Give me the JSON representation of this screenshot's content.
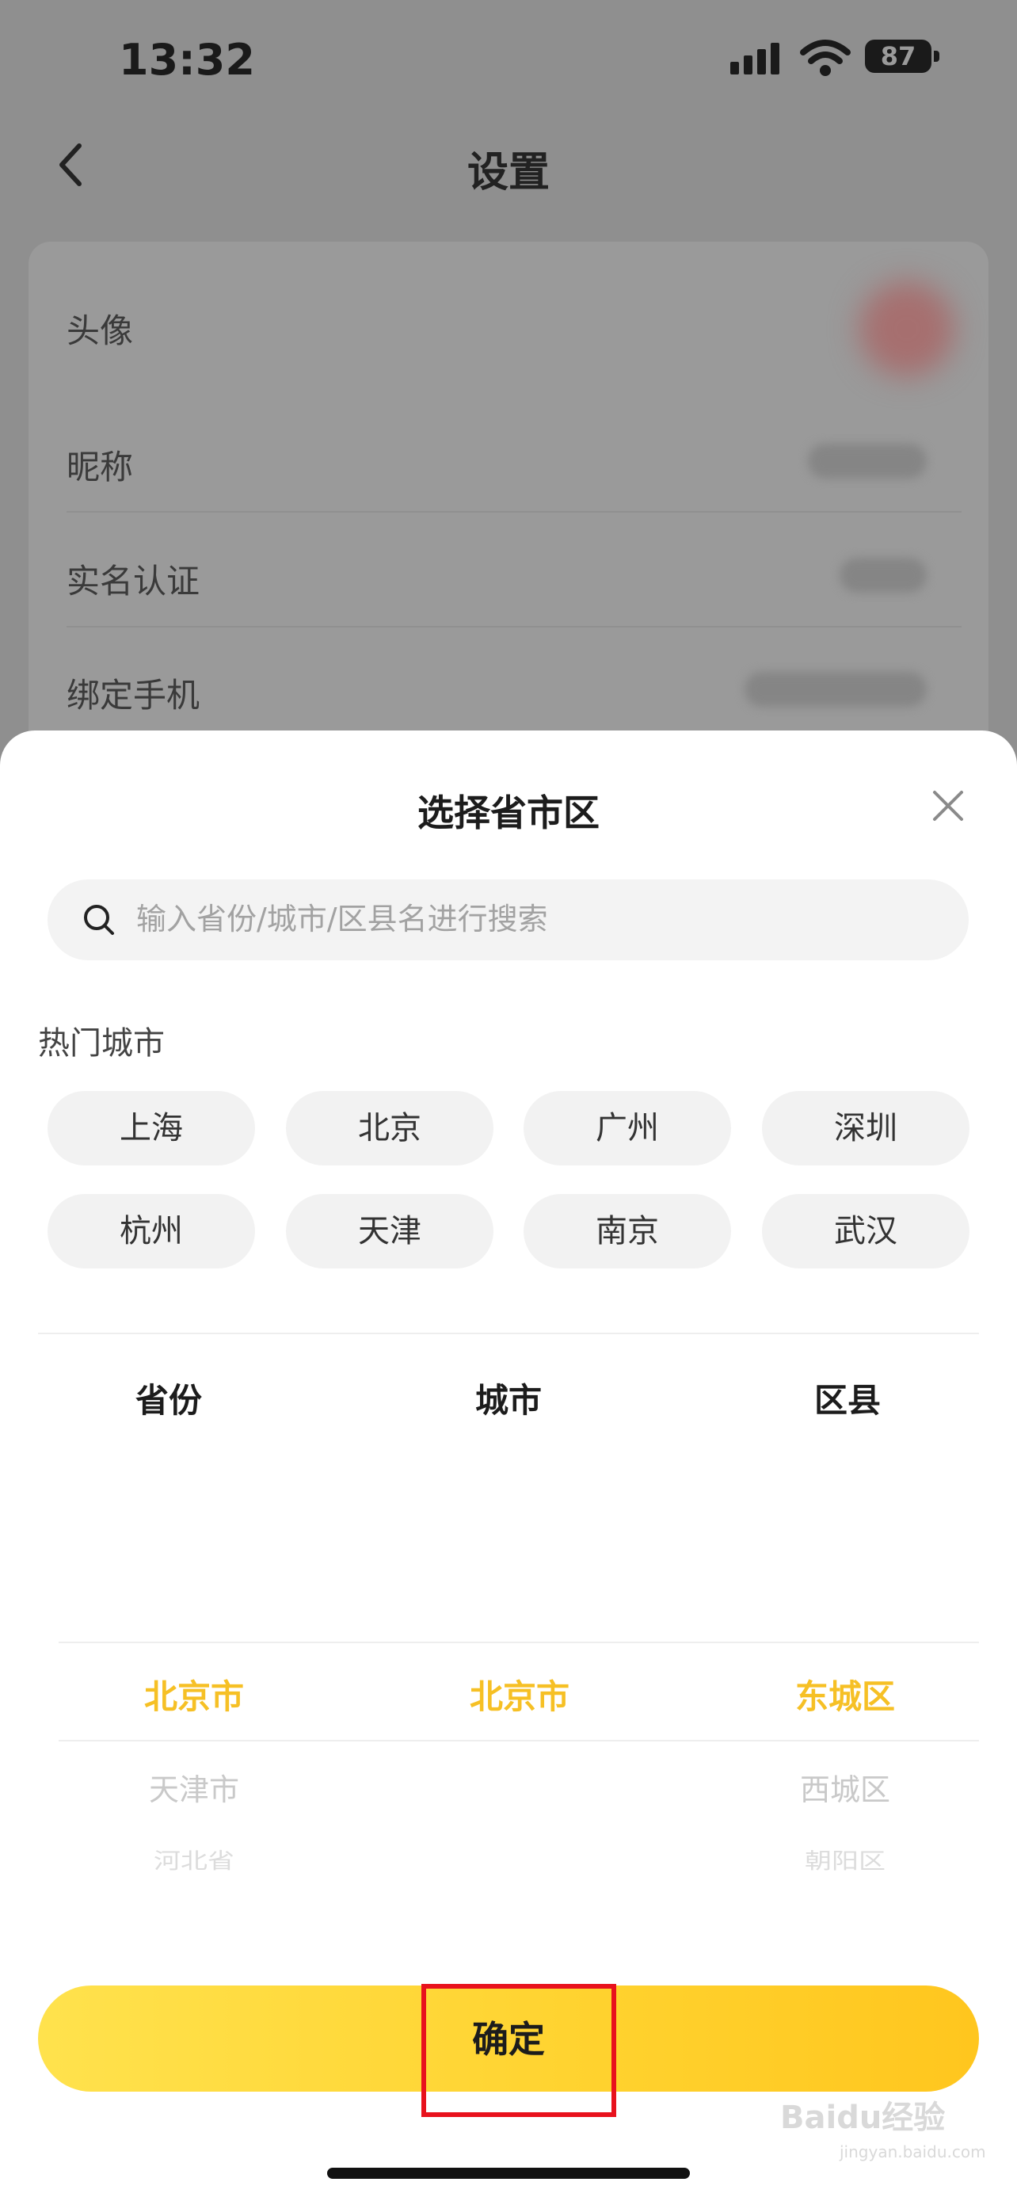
{
  "status_bar": {
    "time": "13:32",
    "battery": "87"
  },
  "header": {
    "title": "设置"
  },
  "settings": {
    "rows": [
      {
        "label": "头像"
      },
      {
        "label": "昵称"
      },
      {
        "label": "实名认证"
      },
      {
        "label": "绑定手机"
      }
    ]
  },
  "sheet": {
    "title": "选择省市区",
    "search_placeholder": "输入省份/城市/区县名进行搜索",
    "hot_title": "热门城市",
    "hot_cities": [
      "上海",
      "北京",
      "广州",
      "深圳",
      "杭州",
      "天津",
      "南京",
      "武汉"
    ],
    "columns": [
      "省份",
      "城市",
      "区县"
    ],
    "province": {
      "selected": "北京市",
      "below": [
        "天津市",
        "河北省"
      ]
    },
    "city": {
      "selected": "北京市"
    },
    "district": {
      "selected": "东城区",
      "below": [
        "西城区",
        "朝阳区"
      ]
    },
    "confirm_label": "确定"
  },
  "watermark": {
    "text": "Baidu经验",
    "sub": "jingyan.baidu.com"
  },
  "colors": {
    "accent": "#f6c025",
    "button": "#ffd22e",
    "highlight": "#e8121d"
  },
  "icons": [
    "back-chevron-icon",
    "close-icon",
    "search-icon",
    "signal-icon",
    "wifi-icon",
    "battery-icon"
  ]
}
